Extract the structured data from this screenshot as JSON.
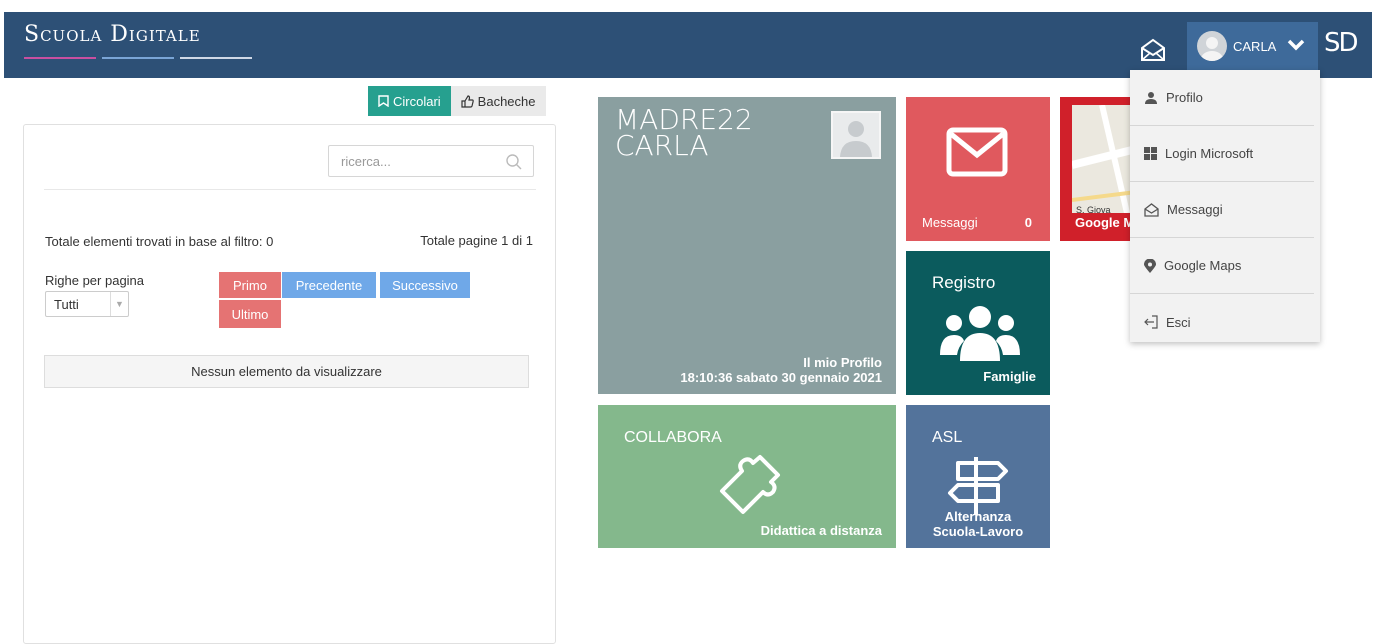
{
  "header": {
    "logo": "Scuola Digitale",
    "user_name": "CARLA",
    "sd_logo": "SD",
    "color": "#2d5076"
  },
  "tabs": {
    "circolari": "Circolari",
    "bacheche": "Bacheche"
  },
  "list": {
    "search_placeholder": "ricerca...",
    "total_elements": "Totale elementi trovati in base al filtro: 0",
    "total_pages": "Totale pagine 1 di 1",
    "rows_label": "Righe per pagina",
    "rows_value": "Tutti",
    "btn_primo": "Primo",
    "btn_precedente": "Precedente",
    "btn_successivo": "Successivo",
    "btn_ultimo": "Ultimo",
    "empty_message": "Nessun elemento da visualizzare"
  },
  "tiles": {
    "profile_line1": "MADRE22",
    "profile_line2": "CARLA",
    "profile_label": "Il mio Profilo",
    "profile_datetime": "18:10:36 sabato 30 gennaio 2021",
    "messages_label": "Messaggi",
    "messages_count": "0",
    "maps_label": "Google Maps",
    "maps_street": "S. Giova",
    "registro_title": "Registro",
    "registro_label": "Famiglie",
    "collabora_title": "COLLABORA",
    "collabora_label": "Didattica a distanza",
    "asl_title": "ASL",
    "asl_label_1": "Alternanza",
    "asl_label_2": "Scuola-Lavoro"
  },
  "menu": {
    "items": [
      {
        "label": "Profilo",
        "icon": "user-icon"
      },
      {
        "label": "Login Microsoft",
        "icon": "windows-icon"
      },
      {
        "label": "Messaggi",
        "icon": "envelope-open-icon"
      },
      {
        "label": "Google Maps",
        "icon": "map-marker-icon"
      },
      {
        "label": "Esci",
        "icon": "sign-out-icon"
      }
    ]
  }
}
